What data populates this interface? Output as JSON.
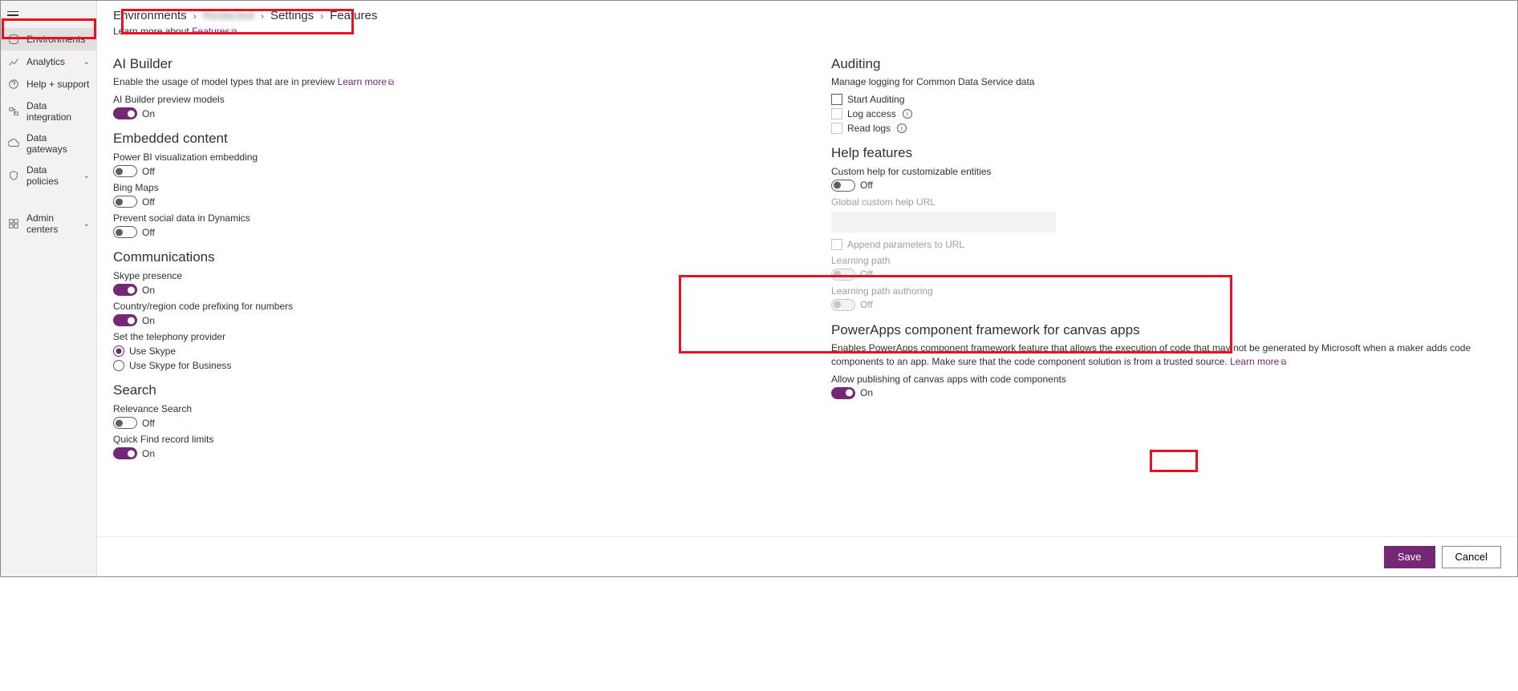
{
  "sidebar": {
    "items": [
      {
        "label": "Environments"
      },
      {
        "label": "Analytics"
      },
      {
        "label": "Help + support"
      },
      {
        "label": "Data integration"
      },
      {
        "label": "Data gateways"
      },
      {
        "label": "Data policies"
      },
      {
        "label": "Admin centers"
      }
    ]
  },
  "breadcrumb": {
    "a": "Environments",
    "b": "Redacted",
    "c": "Settings",
    "d": "Features"
  },
  "learn_prefix": "Learn more about ",
  "learn_link": "Features",
  "left": {
    "ai": {
      "title": "AI Builder",
      "desc": "Enable the usage of model types that are in preview ",
      "learn": "Learn more",
      "field1": "AI Builder preview models",
      "state1": "On"
    },
    "embedded": {
      "title": "Embedded content",
      "f1": "Power BI visualization embedding",
      "s1": "Off",
      "f2": "Bing Maps",
      "s2": "Off",
      "f3": "Prevent social data in Dynamics",
      "s3": "Off"
    },
    "comm": {
      "title": "Communications",
      "f1": "Skype presence",
      "s1": "On",
      "f2": "Country/region code prefixing for numbers",
      "s2": "On",
      "f3": "Set the telephony provider",
      "r1": "Use Skype",
      "r2": "Use Skype for Business"
    },
    "search": {
      "title": "Search",
      "f1": "Relevance Search",
      "s1": "Off",
      "f2": "Quick Find record limits",
      "s2": "On"
    }
  },
  "right": {
    "audit": {
      "title": "Auditing",
      "desc": "Manage logging for Common Data Service data",
      "c1": "Start Auditing",
      "c2": "Log access",
      "c3": "Read logs"
    },
    "help": {
      "title": "Help features",
      "f1": "Custom help for customizable entities",
      "s1": "Off",
      "f2": "Global custom help URL",
      "f3": "Append parameters to URL",
      "f4": "Learning path",
      "s4": "Off",
      "f5": "Learning path authoring",
      "s5": "Off"
    },
    "pcf": {
      "title": "PowerApps component framework for canvas apps",
      "desc": "Enables PowerApps component framework feature that allows the execution of code that may not be generated by Microsoft when a maker adds code components to an app. Make sure that the code component solution is from a trusted source. ",
      "learn": "Learn more",
      "f1": "Allow publishing of canvas apps with code components",
      "s1": "On"
    }
  },
  "footer": {
    "save": "Save",
    "cancel": "Cancel"
  }
}
